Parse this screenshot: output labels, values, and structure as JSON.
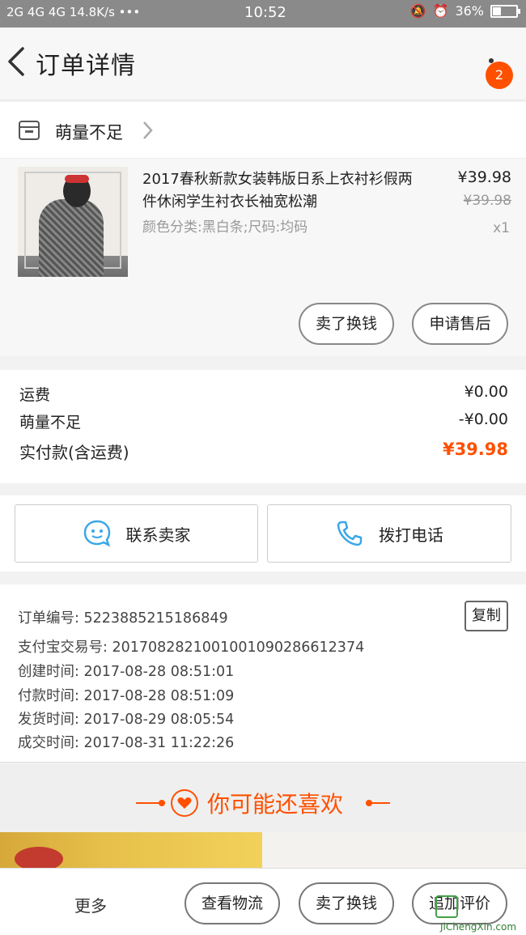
{
  "status_bar": {
    "network": "2G 4G 4G 14.8K/s •••",
    "time": "10:52",
    "battery_percent": "36%",
    "battery_level": 0.36
  },
  "header": {
    "title": "订单详情",
    "notification_count": "2"
  },
  "shop": {
    "name": "萌量不足"
  },
  "product": {
    "title": "2017春秋新款女装韩版日系上衣衬衫假两件休闲学生衬衣长袖宽松潮",
    "sku": "颜色分类:黑白条;尺码:均码",
    "price": "¥39.98",
    "original_price": "¥39.98",
    "quantity": "x1",
    "buttons": {
      "sell": "卖了换钱",
      "after_sales": "申请售后"
    }
  },
  "fees": {
    "shipping_label": "运费",
    "shipping_value": "¥0.00",
    "discount_label": "萌量不足",
    "discount_value": "-¥0.00",
    "total_label": "实付款(含运费)",
    "total_value": "¥39.98"
  },
  "contact": {
    "seller": "联系卖家",
    "call": "拨打电话"
  },
  "order_info": {
    "order_no": "订单编号: 5223885215186849",
    "copy": "复制",
    "alipay_no": "支付宝交易号: 2017082821001001090286612374",
    "created": "创建时间: 2017-08-28 08:51:01",
    "paid": "付款时间: 2017-08-28 08:51:09",
    "shipped": "发货时间: 2017-08-29 08:05:54",
    "completed": "成交时间: 2017-08-31 11:22:26"
  },
  "recommend": {
    "title": "你可能还喜欢"
  },
  "bottom_bar": {
    "more": "更多",
    "logistics": "查看物流",
    "sell": "卖了换钱",
    "review": "追加评价"
  },
  "watermark": {
    "url": "JiChengXin.com"
  },
  "colors": {
    "accent": "#ff5000",
    "contact_icon": "#3aa7e8"
  }
}
